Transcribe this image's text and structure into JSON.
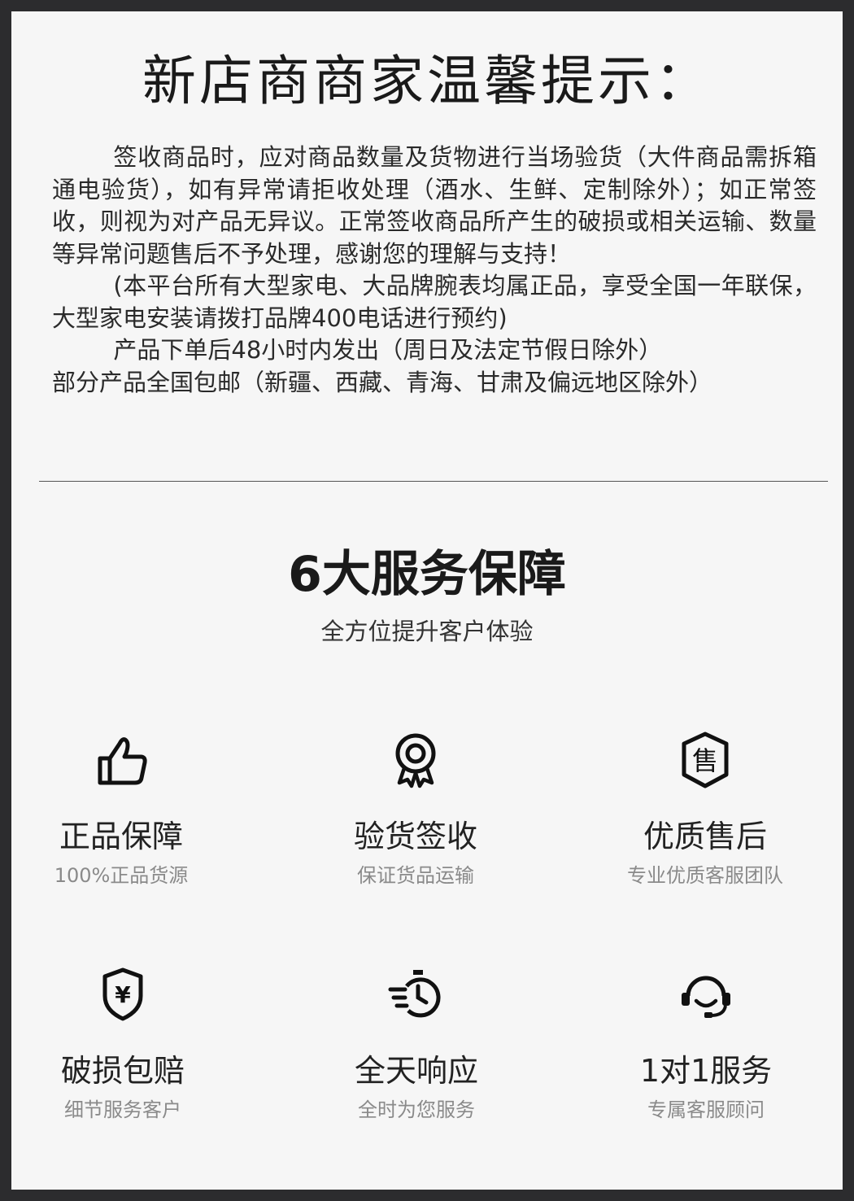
{
  "notice": {
    "title": "新店商商家温馨提示：",
    "paragraphs": [
      "签收商品时，应对商品数量及货物进行当场验货（大件商品需拆箱通电验货），如有异常请拒收处理（酒水、生鲜、定制除外）；如正常签收，则视为对产品无异议。正常签收商品所产生的破损或相关运输、数量等异常问题售后不予处理，感谢您的理解与支持！",
      "(本平台所有大型家电、大品牌腕表均属正品，享受全国一年联保，大型家电安装请拨打品牌400电话进行预约)",
      "产品下单后48小时内发出（周日及法定节假日除外）",
      "部分产品全国包邮（新疆、西藏、青海、甘肃及偏远地区除外）"
    ]
  },
  "services": {
    "title": "6大服务保障",
    "subtitle": "全方位提升客户体验",
    "items": [
      {
        "icon": "thumbs-up-icon",
        "name": "正品保障",
        "desc": "100%正品货源"
      },
      {
        "icon": "award-medal-icon",
        "name": "验货签收",
        "desc": "保证货品运输"
      },
      {
        "icon": "after-sales-shield-icon",
        "name": "优质售后",
        "desc": "专业优质客服团队",
        "icon_text": "售"
      },
      {
        "icon": "yuan-shield-icon",
        "name": "破损包赔",
        "desc": "细节服务客户",
        "icon_text": "¥"
      },
      {
        "icon": "stopwatch-fast-icon",
        "name": "全天响应",
        "desc": "全时为您服务"
      },
      {
        "icon": "headset-icon",
        "name": "1对1服务",
        "desc": "专属客服顾问"
      }
    ]
  }
}
